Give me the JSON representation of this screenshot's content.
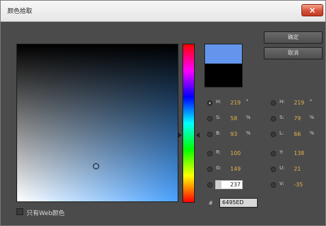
{
  "dialog": {
    "title": "颜色拾取",
    "close_glyph": "×"
  },
  "buttons": {
    "ok_label": "确定",
    "cancel_label": "取消"
  },
  "colors": {
    "new_color": "#6495ED",
    "old_color": "#000000"
  },
  "hsb": {
    "h": {
      "label": "H:",
      "value": "219",
      "unit": "°",
      "selected": true
    },
    "s": {
      "label": "S:",
      "value": "58",
      "unit": "%"
    },
    "b": {
      "label": "B:",
      "value": "93",
      "unit": "%"
    }
  },
  "rgb": {
    "r": {
      "label": "R:",
      "value": "100"
    },
    "g": {
      "label": "G:",
      "value": "149"
    },
    "b": {
      "label": "B:",
      "value": "237"
    }
  },
  "hsl": {
    "h": {
      "label": "H:",
      "value": "219",
      "unit": "°"
    },
    "s": {
      "label": "S:",
      "value": "79",
      "unit": "%"
    },
    "l": {
      "label": "L:",
      "value": "66",
      "unit": "%"
    }
  },
  "yuv": {
    "y": {
      "label": "Y:",
      "value": "138"
    },
    "u": {
      "label": "U:",
      "value": "21"
    },
    "v": {
      "label": "V:",
      "value": "-35"
    }
  },
  "hex": {
    "hash": "#",
    "value": "6495ED"
  },
  "web_safe": {
    "label": "只有Web颜色",
    "checked": false
  }
}
